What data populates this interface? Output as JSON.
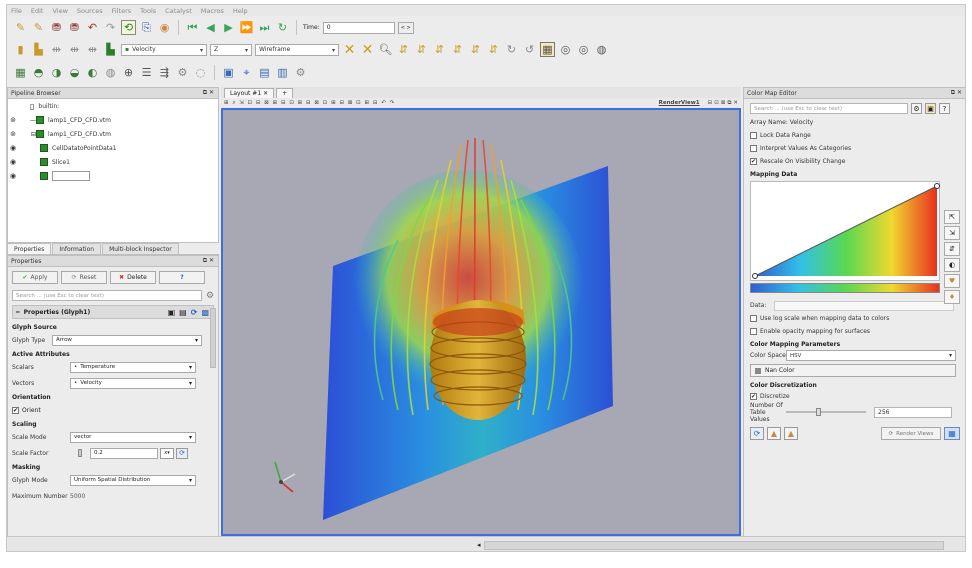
{
  "menubar": [
    "File",
    "Edit",
    "View",
    "Sources",
    "Filters",
    "Tools",
    "Catalyst",
    "Macros",
    "Help"
  ],
  "toolbar": {
    "time_label": "Time:",
    "time_value": "0",
    "spin_value": "< >",
    "color_by": "Velocity",
    "component": "Z",
    "representation": "Wireframe"
  },
  "pipeline": {
    "title": "Pipeline Browser",
    "items": [
      {
        "label": "builtin:"
      },
      {
        "label": "lamp1_CFD_CFD.vtm"
      },
      {
        "label": "lamp1_CFD_CFD.vtm"
      },
      {
        "label": "CellDatatoPointData1"
      },
      {
        "label": "Slice1"
      },
      {
        "label": ""
      }
    ]
  },
  "bottom_tabs": [
    "Properties",
    "Information",
    "Multi-block Inspector"
  ],
  "properties": {
    "title": "Properties",
    "apply": "Apply",
    "reset": "Reset",
    "delete": "Delete",
    "help": "?",
    "search_placeholder": "Search ... (use Esc to clear text)",
    "header": "Properties (Glyph1)",
    "glyph_source_head": "Glyph Source",
    "glyph_type_label": "Glyph Type",
    "glyph_type_value": "Arrow",
    "active_attr_head": "Active Attributes",
    "scalars_label": "Scalars",
    "scalars_value": "Temperature",
    "vectors_label": "Vectors",
    "vectors_value": "Velocity",
    "orientation_head": "Orientation",
    "orient_label": "Orient",
    "scaling_head": "Scaling",
    "scale_mode_label": "Scale Mode",
    "scale_mode_value": "vector",
    "scale_factor_label": "Scale Factor",
    "scale_factor_value": "0.2",
    "masking_head": "Masking",
    "glyph_mode_label": "Glyph Mode",
    "glyph_mode_value": "Uniform Spatial Distribution",
    "max_number_label": "Maximum Number",
    "max_number_value": "5000"
  },
  "layout": {
    "tab": "Layout #1",
    "plus": "+",
    "render_view": "RenderView1"
  },
  "cme": {
    "title": "Color Map Editor",
    "search_placeholder": "Search ... (use Esc to clear text)",
    "array_name": "Array Name: Velocity",
    "lock_data_range": "Lock Data Range",
    "interpret_categories": "Interpret Values As Categories",
    "rescale_visibility": "Rescale On Visibility Change",
    "mapping_data": "Mapping Data",
    "data_label": "Data:",
    "use_log": "Use log scale when mapping data to colors",
    "enable_opacity": "Enable opacity mapping for surfaces",
    "color_mapping_params": "Color Mapping Parameters",
    "color_space_label": "Color Space",
    "color_space_value": "HSV",
    "nan_color": "Nan Color",
    "color_discretization": "Color Discretization",
    "discretize": "Discretize",
    "num_table_values_label": "Number Of Table Values",
    "num_table_values": "256",
    "render_views": "Render Views"
  },
  "colors": {
    "accent_border": "#3d6fe0",
    "background_view": "#a8a8b4"
  }
}
